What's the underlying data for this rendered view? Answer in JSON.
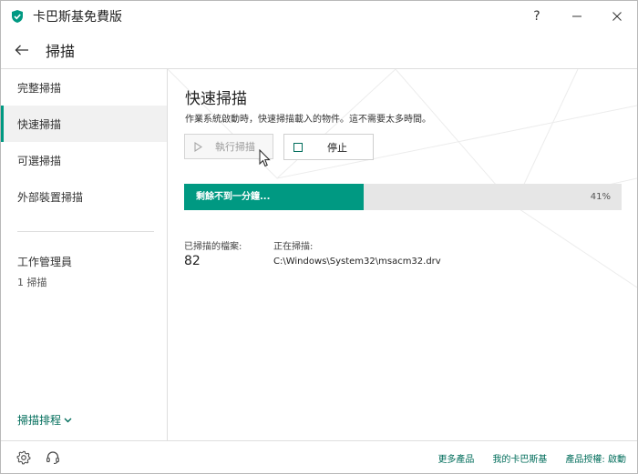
{
  "app": {
    "title": "卡巴斯基免費版",
    "accent": "#009982",
    "link_color": "#006d5b"
  },
  "window_controls": {
    "help": "?",
    "minimize": "—",
    "close": "✕"
  },
  "header": {
    "title": "掃描",
    "back_icon": "arrow-left-icon"
  },
  "sidebar": {
    "items": [
      {
        "label": "完整掃描"
      },
      {
        "label": "快速掃描",
        "active": true
      },
      {
        "label": "可選掃描"
      },
      {
        "label": "外部裝置掃描"
      }
    ],
    "task_manager": {
      "title": "工作管理員",
      "subtitle": "1 掃描"
    },
    "schedule": "掃描排程"
  },
  "main": {
    "title": "快速掃描",
    "description": "作業系統啟動時，快速掃描載入的物件。這不需要太多時間。",
    "run_button": "執行掃描",
    "stop_button": "停止",
    "progress": {
      "label": "剩餘不到一分鐘...",
      "percent_text": "41%",
      "value": 0.41
    },
    "scanned_files_label": "已掃描的檔案:",
    "scanned_files_value": "82",
    "scanning_label": "正在掃描:",
    "scanning_path": "C:\\Windows\\System32\\msacm32.drv"
  },
  "footer": {
    "links": [
      "更多產品",
      "我的卡巴斯基",
      "產品授權: 啟動"
    ],
    "icons": [
      "gear-icon",
      "headset-icon"
    ]
  }
}
